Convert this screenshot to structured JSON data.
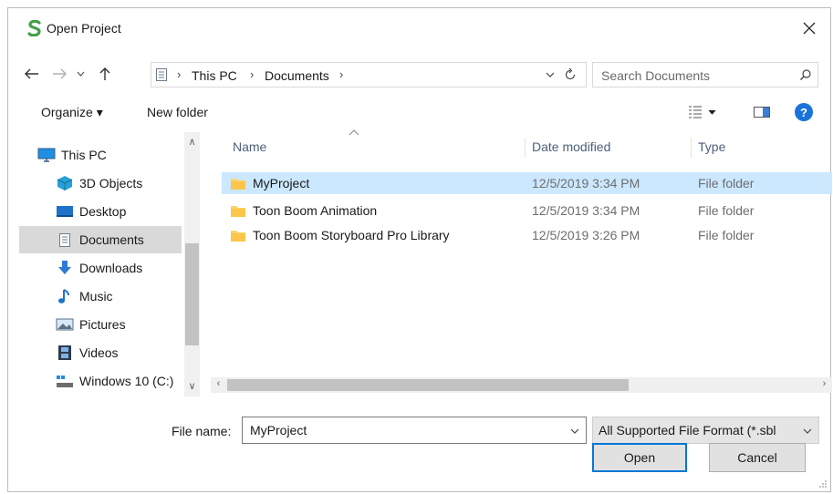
{
  "window": {
    "title": "Open Project",
    "accent": "#0078d7",
    "logo_color": "#43a047"
  },
  "address": {
    "crumbs": [
      "This PC",
      "Documents"
    ],
    "search_placeholder": "Search Documents"
  },
  "toolbar": {
    "organize_label": "Organize ▾",
    "new_folder_label": "New folder",
    "help_label": "?"
  },
  "nav": {
    "items": [
      {
        "label": "This PC",
        "icon": "computer-icon"
      },
      {
        "label": "3D Objects",
        "icon": "cube-icon"
      },
      {
        "label": "Desktop",
        "icon": "desktop-icon"
      },
      {
        "label": "Documents",
        "icon": "documents-icon"
      },
      {
        "label": "Downloads",
        "icon": "download-arrow-icon"
      },
      {
        "label": "Music",
        "icon": "music-note-icon"
      },
      {
        "label": "Pictures",
        "icon": "pictures-icon"
      },
      {
        "label": "Videos",
        "icon": "film-icon"
      },
      {
        "label": "Windows 10 (C:)",
        "icon": "drive-icon"
      }
    ]
  },
  "files": {
    "columns": [
      "Name",
      "Date modified",
      "Type"
    ],
    "rows": [
      {
        "name": "MyProject",
        "date": "12/5/2019 3:34 PM",
        "type": "File folder"
      },
      {
        "name": "Toon Boom Animation",
        "date": "12/5/2019 3:34 PM",
        "type": "File folder"
      },
      {
        "name": "Toon Boom Storyboard Pro Library",
        "date": "12/5/2019 3:26 PM",
        "type": "File folder"
      }
    ]
  },
  "bottom": {
    "file_name_label": "File name:",
    "file_name_value": "MyProject",
    "filter_value": "All Supported File Format (*.sbl",
    "open_label": "Open",
    "cancel_label": "Cancel"
  }
}
